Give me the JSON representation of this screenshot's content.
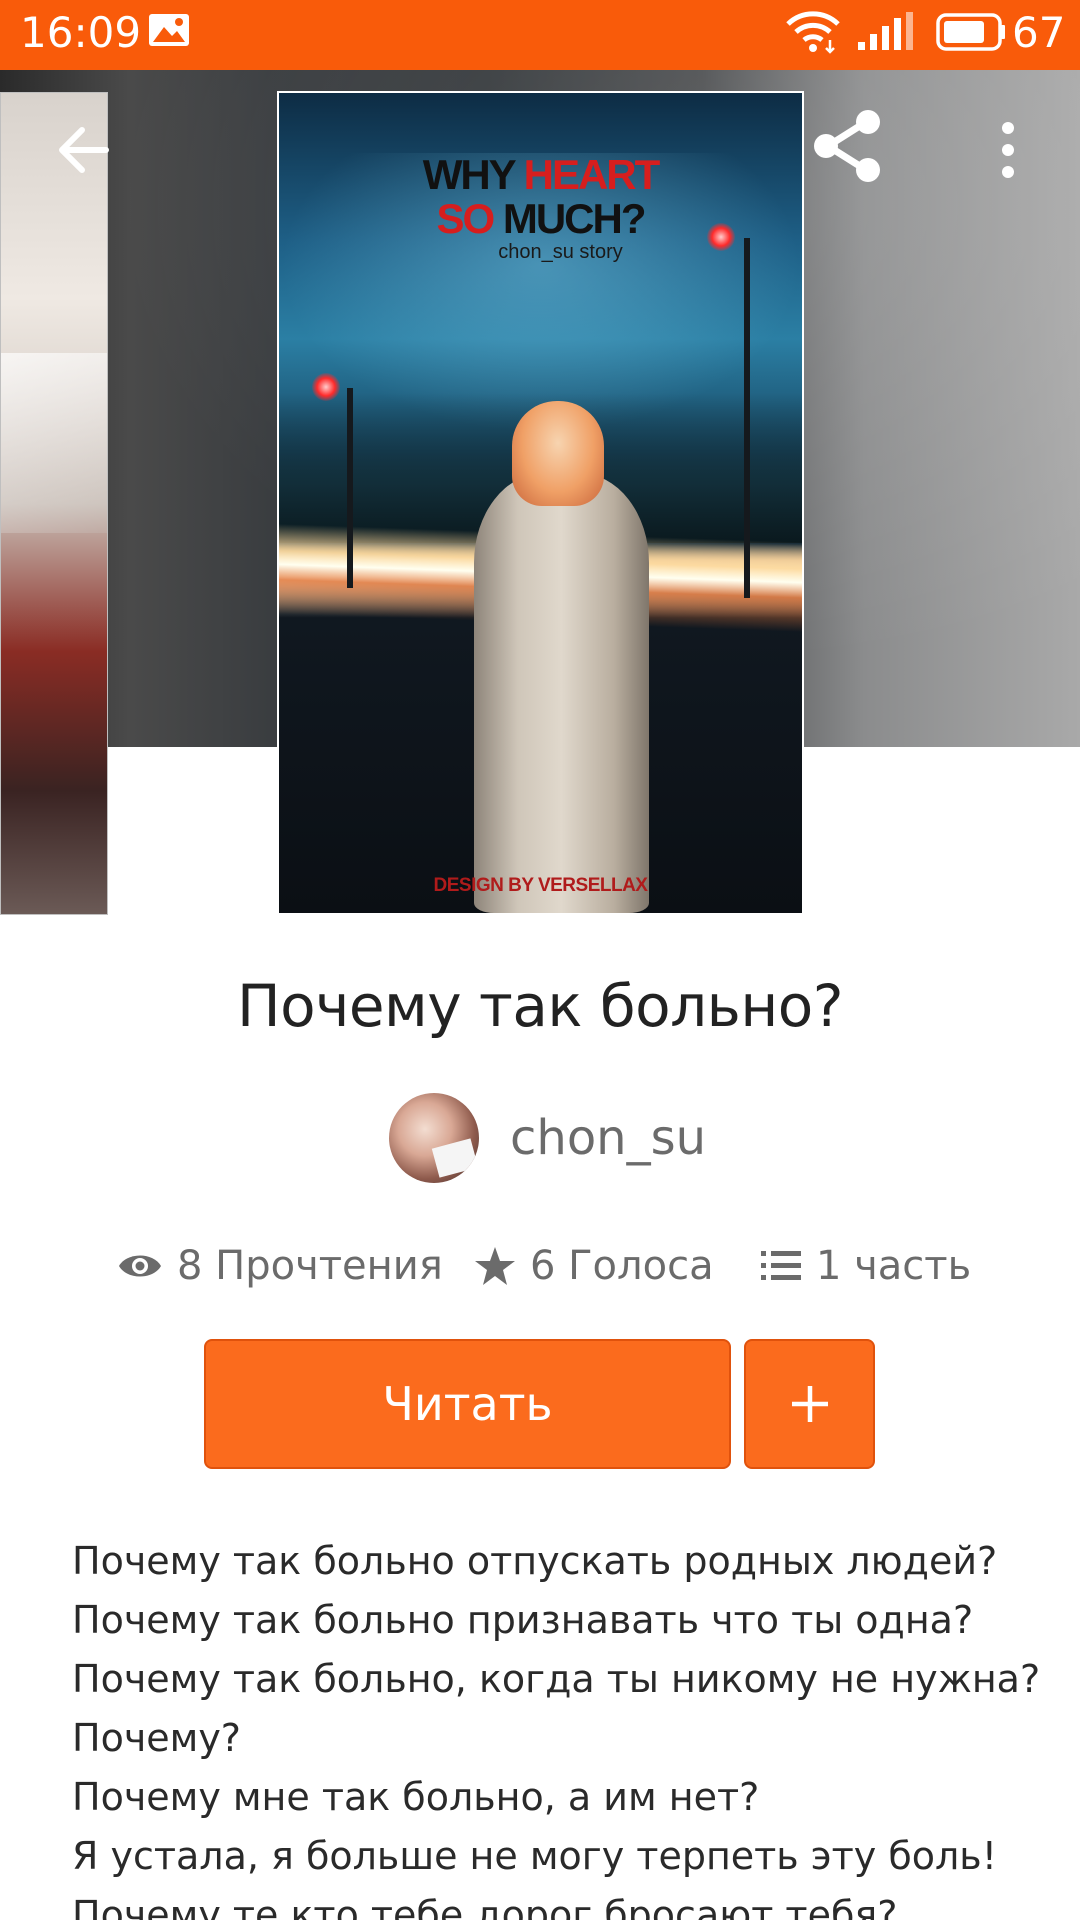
{
  "status_bar": {
    "time": "16:09",
    "battery": "67",
    "icons": [
      "image-notification-icon",
      "wifi-icon",
      "signal-icon",
      "battery-icon"
    ]
  },
  "header": {
    "back_icon": "arrow-left-icon",
    "share_icon": "share-icon",
    "more_icon": "more-vert-icon"
  },
  "cover": {
    "title_part1": "WHY ",
    "title_part2": "HEART",
    "title_part3": "SO",
    "title_part4": " MUCH?",
    "subtitle": "chon_su story",
    "credit": "DESIGN BY VERSELLAX"
  },
  "story": {
    "title": "Почему так больно?",
    "author": "chon_su"
  },
  "stats": {
    "reads": "8 Прочтения",
    "votes": "6 Голоса",
    "parts": "1 часть"
  },
  "actions": {
    "read_label": "Читать",
    "add_icon": "plus-icon"
  },
  "description": {
    "lines": [
      "Почему так больно отпускать родных людей?",
      "Почему так больно признавать что ты одна?",
      "Почему так больно, когда ты никому не нужна?",
      "Почему?",
      "Почему мне так больно, а им нет?",
      "Я устала, я больше не могу терпеть эту боль!",
      "Почему те кто тебе дорог бросают тебя?"
    ]
  },
  "colors": {
    "accent": "#fb6b1d",
    "status_bar": "#f95b0a"
  }
}
